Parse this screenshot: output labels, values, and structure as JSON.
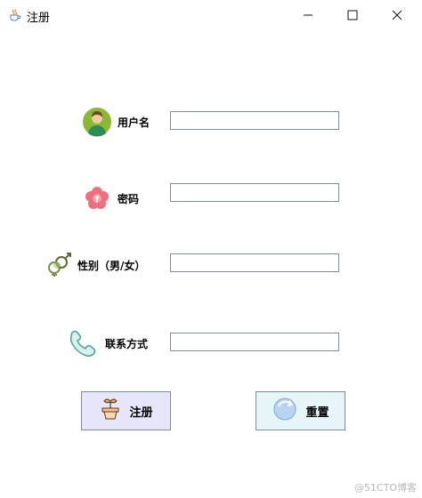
{
  "window": {
    "title": "注册",
    "icon": "java-coffee-icon",
    "controls": [
      "minimize-icon",
      "maximize-icon",
      "close-icon"
    ]
  },
  "form": {
    "username_label": "用户名",
    "password_label": "密码",
    "gender_label": "性别（男/女）",
    "contact_label": "联系方式",
    "username_value": "",
    "password_value": "",
    "gender_value": "",
    "contact_value": ""
  },
  "buttons": {
    "register_label": "注册",
    "reset_label": "重置"
  },
  "icons": {
    "username": "user-avatar-icon",
    "password": "flower-icon",
    "gender": "gender-symbols-icon",
    "contact": "phone-icon",
    "register": "flowerpot-icon",
    "reset": "refresh-icon"
  },
  "watermark": "@51CTO博客",
  "colors": {
    "register_button_bg": "#e6e6f8",
    "reset_button_bg": "#e6f6f8",
    "field_border": "#7a8a9e"
  }
}
